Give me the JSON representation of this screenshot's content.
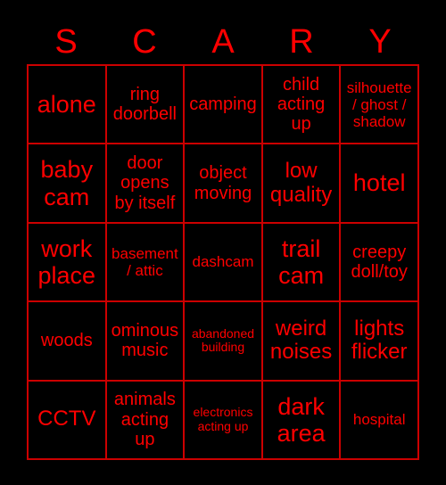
{
  "card": {
    "title_letters": [
      "S",
      "C",
      "A",
      "R",
      "Y"
    ],
    "colors": {
      "background": "#000000",
      "text": "#ff0000",
      "border": "#cc0000"
    },
    "grid": {
      "columns": 5,
      "rows": 5,
      "cells": [
        {
          "text": "alone",
          "size": "xl"
        },
        {
          "text": "ring\ndoorbell",
          "size": "md"
        },
        {
          "text": "camping",
          "size": "md"
        },
        {
          "text": "child\nacting\nup",
          "size": "md"
        },
        {
          "text": "silhouette\n/ ghost /\nshadow",
          "size": "sm"
        },
        {
          "text": "baby\ncam",
          "size": "xl"
        },
        {
          "text": "door\nopens\nby itself",
          "size": "md"
        },
        {
          "text": "object\nmoving",
          "size": "md"
        },
        {
          "text": "low\nquality",
          "size": "lg"
        },
        {
          "text": "hotel",
          "size": "xl"
        },
        {
          "text": "work\nplace",
          "size": "xl"
        },
        {
          "text": "basement\n/ attic",
          "size": "sm"
        },
        {
          "text": "dashcam",
          "size": "sm"
        },
        {
          "text": "trail\ncam",
          "size": "xl"
        },
        {
          "text": "creepy\ndoll/toy",
          "size": "md"
        },
        {
          "text": "woods",
          "size": "md"
        },
        {
          "text": "ominous\nmusic",
          "size": "md"
        },
        {
          "text": "abandoned\nbuilding",
          "size": "xs"
        },
        {
          "text": "weird\nnoises",
          "size": "lg"
        },
        {
          "text": "lights\nflicker",
          "size": "lg"
        },
        {
          "text": "CCTV",
          "size": "lg"
        },
        {
          "text": "animals\nacting\nup",
          "size": "md"
        },
        {
          "text": "electronics\nacting up",
          "size": "xs"
        },
        {
          "text": "dark\narea",
          "size": "xl"
        },
        {
          "text": "hospital",
          "size": "sm"
        }
      ]
    }
  }
}
